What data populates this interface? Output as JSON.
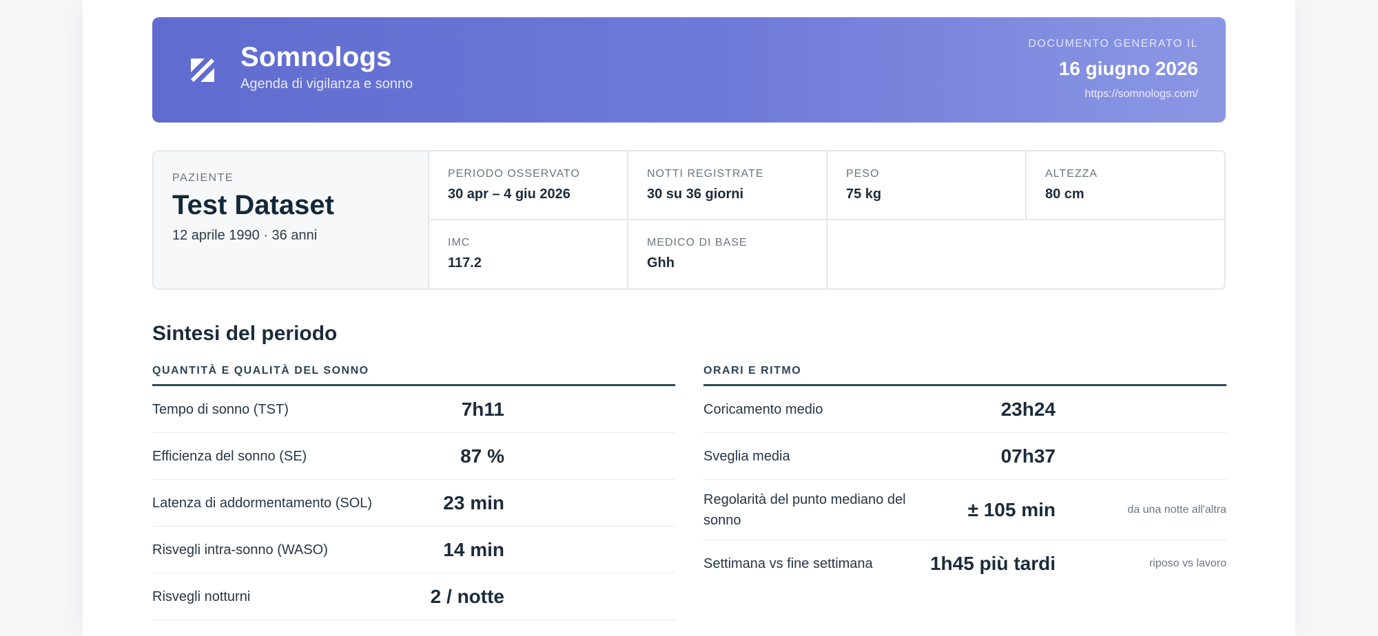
{
  "header": {
    "brand_name": "Somnologs",
    "brand_tagline": "Agenda di vigilanza e sonno",
    "generated_label": "DOCUMENTO GENERATO IL",
    "generated_date": "16 giugno 2026",
    "url": "https://somnologs.com/",
    "logo_icon": "somnologs-logo-icon",
    "gradient_start": "#5f6bcf",
    "gradient_end": "#8b97e4"
  },
  "patient": {
    "label": "PAZIENTE",
    "name": "Test Dataset",
    "dob_age": "12 aprile 1990 · 36 anni",
    "fields": [
      {
        "label": "PERIODO OSSERVATO",
        "value": "30 apr – 4 giu 2026"
      },
      {
        "label": "NOTTI REGISTRATE",
        "value": "30 su 36 giorni"
      },
      {
        "label": "PESO",
        "value": "75 kg"
      },
      {
        "label": "ALTEZZA",
        "value": "80 cm"
      },
      {
        "label": "IMC",
        "value": "117.2"
      },
      {
        "label": "MEDICO DI BASE",
        "value": "Ghh"
      }
    ]
  },
  "summary": {
    "title": "Sintesi del periodo",
    "left": {
      "heading": "QUANTITÀ E QUALITÀ DEL SONNO",
      "rows": [
        {
          "label": "Tempo di sonno (TST)",
          "value": "7h11"
        },
        {
          "label": "Efficienza del sonno (SE)",
          "value": "87 %"
        },
        {
          "label": "Latenza di addormentamento (SOL)",
          "value": "23 min"
        },
        {
          "label": "Risvegli intra-sonno (WASO)",
          "value": "14 min"
        },
        {
          "label": "Risvegli notturni",
          "value": "2 / notte"
        }
      ]
    },
    "right": {
      "heading": "ORARI E RITMO",
      "rows": [
        {
          "label": "Coricamento medio",
          "value": "23h24",
          "note": ""
        },
        {
          "label": "Sveglia media",
          "value": "07h37",
          "note": ""
        },
        {
          "label": "Regolarità del punto mediano del sonno",
          "value": "± 105 min",
          "note": "da una notte all'altra"
        },
        {
          "label": "Settimana vs fine settimana",
          "value": "1h45 più tardi",
          "note": "riposo vs lavoro"
        }
      ]
    }
  }
}
